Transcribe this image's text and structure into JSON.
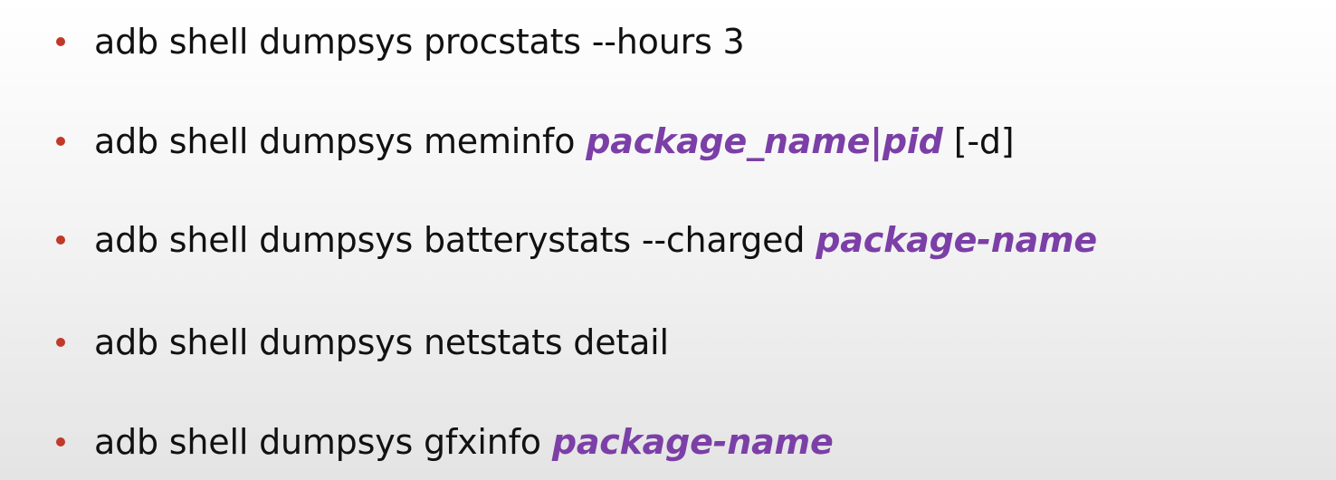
{
  "colors": {
    "bullet": "#c0392b",
    "text": "#111111",
    "argument": "#7b3fa7"
  },
  "items": [
    {
      "command": "adb shell dumpsys procstats --hours 3",
      "argument": "",
      "option": ""
    },
    {
      "command": "adb shell dumpsys meminfo",
      "argument": "package_name|pid",
      "option": "[-d]"
    },
    {
      "command": "adb shell dumpsys batterystats --charged",
      "argument": "package-name",
      "option": ""
    },
    {
      "command": "adb shell dumpsys netstats detail",
      "argument": "",
      "option": ""
    },
    {
      "command": "adb shell dumpsys gfxinfo",
      "argument": "package-name",
      "option": ""
    }
  ]
}
